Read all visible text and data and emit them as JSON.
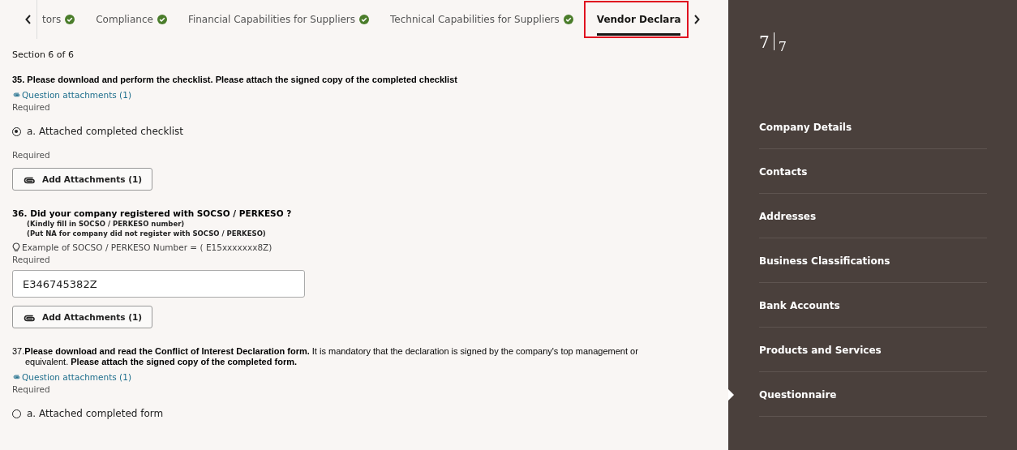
{
  "tabs": [
    {
      "label": "tors",
      "completed": true,
      "selected": false,
      "highlighted": false
    },
    {
      "label": "Compliance",
      "completed": true,
      "selected": false,
      "highlighted": false
    },
    {
      "label": "Financial Capabilities for Suppliers",
      "completed": true,
      "selected": false,
      "highlighted": false
    },
    {
      "label": "Technical Capabilities for Suppliers",
      "completed": true,
      "selected": false,
      "highlighted": false
    },
    {
      "label": "Vendor Declara",
      "completed": false,
      "selected": true,
      "highlighted": true
    }
  ],
  "section": "Section 6 of 6",
  "questions": [
    {
      "kind": "choice",
      "title": "35. Please download and perform the checklist. Please attach the signed copy of the completed checklist",
      "attachments_link": "Question attachments (1)",
      "required": "Required",
      "option": {
        "label": "a. Attached completed checklist",
        "checked": true
      },
      "required_2": "Required",
      "button": "Add Attachments (1)"
    },
    {
      "kind": "text",
      "title": "36. Did your company registered with SOCSO / PERKESO ?",
      "notes": [
        "(Kindly fill in SOCSO / PERKESO number)",
        "(Put NA for company did not register with SOCSO / PERKESO)"
      ],
      "hint": "Example of SOCSO / PERKESO Number = ( E15xxxxxxx8Z)",
      "required": "Required",
      "value": "E346745382Z",
      "button": "Add Attachments (1)"
    },
    {
      "kind": "choice",
      "title": "37.**Please download and read the Conflict of Interest Declaration form.** It is mandatory that the declaration is signed by the company's top management or equivalent. **Please attach the signed copy of the completed form.**",
      "attachments_link": "Question attachments (1)",
      "required": "Required",
      "option": {
        "label": "a. Attached completed form",
        "checked": false
      }
    }
  ],
  "step": {
    "current": "7",
    "total": "7"
  },
  "sidebar": {
    "items": [
      {
        "label": "Company Details",
        "selected": false
      },
      {
        "label": "Contacts",
        "selected": false
      },
      {
        "label": "Addresses",
        "selected": false
      },
      {
        "label": "Business Classifications",
        "selected": false
      },
      {
        "label": "Bank Accounts",
        "selected": false
      },
      {
        "label": "Products and Services",
        "selected": false
      },
      {
        "label": "Questionnaire",
        "selected": true
      }
    ]
  }
}
